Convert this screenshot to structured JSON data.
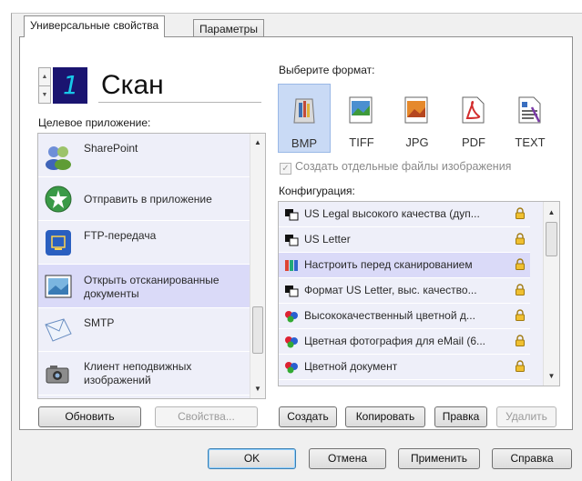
{
  "tabs": [
    {
      "label": "Универсальные свойства",
      "active": true
    },
    {
      "label": "Параметры",
      "active": false
    }
  ],
  "profile": {
    "number": "1",
    "title": "Скан"
  },
  "left": {
    "target_label": "Целевое приложение:",
    "apps": [
      {
        "label": "SharePoint",
        "icon": "sharepoint-icon"
      },
      {
        "label": "Отправить в приложение",
        "icon": "send-to-app-icon"
      },
      {
        "label": "FTP-передача",
        "icon": "ftp-icon"
      },
      {
        "label": "Открыть отсканированные документы",
        "line1": "Открыть отсканированные",
        "line2": "документы",
        "icon": "open-documents-icon",
        "selected": true
      },
      {
        "label": "SMTP",
        "icon": "smtp-mail-icon"
      },
      {
        "label": "Клиент неподвижных изображений",
        "line1": "Клиент неподвижных",
        "line2": "изображений",
        "icon": "still-image-camera-icon"
      }
    ],
    "refresh_button": "Обновить",
    "properties_button": "Свойства..."
  },
  "right": {
    "format_label": "Выберите формат:",
    "formats": [
      {
        "label": "BMP",
        "icon": "bmp-icon",
        "selected": true
      },
      {
        "label": "TIFF",
        "icon": "tiff-icon"
      },
      {
        "label": "JPG",
        "icon": "jpg-icon"
      },
      {
        "label": "PDF",
        "icon": "pdf-icon"
      },
      {
        "label": "TEXT",
        "icon": "text-icon"
      }
    ],
    "separate_files_checkbox": {
      "label": "Создать отдельные файлы изображения",
      "checked": true,
      "enabled": false
    },
    "config_label": "Конфигурация:",
    "configs": [
      {
        "label": "US Legal высокого качества (дуп...",
        "icon": "bw-document-icon"
      },
      {
        "label": "US Letter",
        "icon": "bw-document-icon"
      },
      {
        "label": "Настроить перед сканированием",
        "icon": "configure-icon",
        "selected": true
      },
      {
        "label": "Формат US Letter, выс. качество...",
        "icon": "bw-document-icon"
      },
      {
        "label": "Высококачественный цветной д...",
        "icon": "color-document-icon"
      },
      {
        "label": "Цветная фотография для eMail (6...",
        "icon": "color-document-icon"
      },
      {
        "label": "Цветной документ",
        "icon": "color-document-icon"
      }
    ],
    "buttons": {
      "create": "Создать",
      "copy": "Копировать",
      "edit": "Правка",
      "delete": "Удалить"
    }
  },
  "footer": {
    "ok": "OK",
    "cancel": "Отмена",
    "apply": "Применить",
    "help": "Справка"
  },
  "colors": {
    "selection": "#dadaf8",
    "list_bg": "#eeeff9",
    "display_bg": "#1a1470",
    "display_fg": "#17c8e8"
  }
}
